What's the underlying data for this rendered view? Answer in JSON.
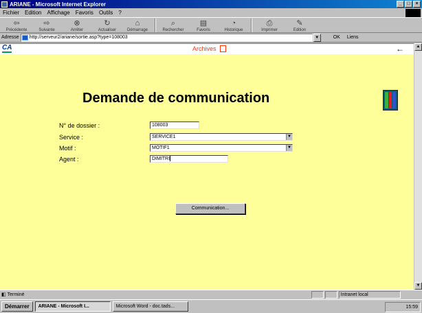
{
  "window": {
    "title": "ARIANE - Microsoft Internet Explorer",
    "controls": [
      "_",
      "□",
      "×"
    ]
  },
  "menubar": {
    "items": [
      "Fichier",
      "Edition",
      "Affichage",
      "Favoris",
      "Outils",
      "?"
    ]
  },
  "toolbar": {
    "buttons": [
      {
        "label": "Précédente",
        "icon": "back-arrow-icon"
      },
      {
        "label": "Suivante",
        "icon": "forward-arrow-icon"
      },
      {
        "label": "Arrêter",
        "icon": "stop-icon"
      },
      {
        "label": "Actualiser",
        "icon": "refresh-icon"
      },
      {
        "label": "Démarrage",
        "icon": "home-icon"
      },
      {
        "label": "Rechercher",
        "icon": "search-icon"
      },
      {
        "label": "Favoris",
        "icon": "favorites-icon"
      },
      {
        "label": "Historique",
        "icon": "history-icon"
      },
      {
        "label": "Imprimer",
        "icon": "print-icon"
      },
      {
        "label": "Edition",
        "icon": "edit-icon"
      }
    ]
  },
  "addressbar": {
    "label": "Adresse",
    "url": "http://serveur2/ariane/sortie.asp?type=108003",
    "go_label": "OK",
    "links_label": "Liens"
  },
  "page": {
    "archives_label": "Archives",
    "title": "Demande de communication",
    "form": {
      "dossier_label": "N° de dossier :",
      "dossier_value": "108003",
      "service_label": "Service :",
      "service_value": "SERVICE1",
      "motif_label": "Motif :",
      "motif_value": "MOTIF1",
      "agent_label": "Agent :",
      "agent_value": "DIMITRI"
    },
    "submit_label": "Communication..."
  },
  "statusbar": {
    "text": "Terminé",
    "zone": "Intranet local"
  },
  "taskbar": {
    "start_label": "Démarrer",
    "tasks": [
      {
        "label": "ARIANE - Microsoft I...",
        "active": true
      },
      {
        "label": "Microsoft Word - doc.tads...",
        "active": false
      }
    ],
    "clock": "15:59"
  },
  "colors": {
    "page_background": "#ffff99",
    "archives_accent": "#ff3300",
    "titlebar": "#000080"
  }
}
